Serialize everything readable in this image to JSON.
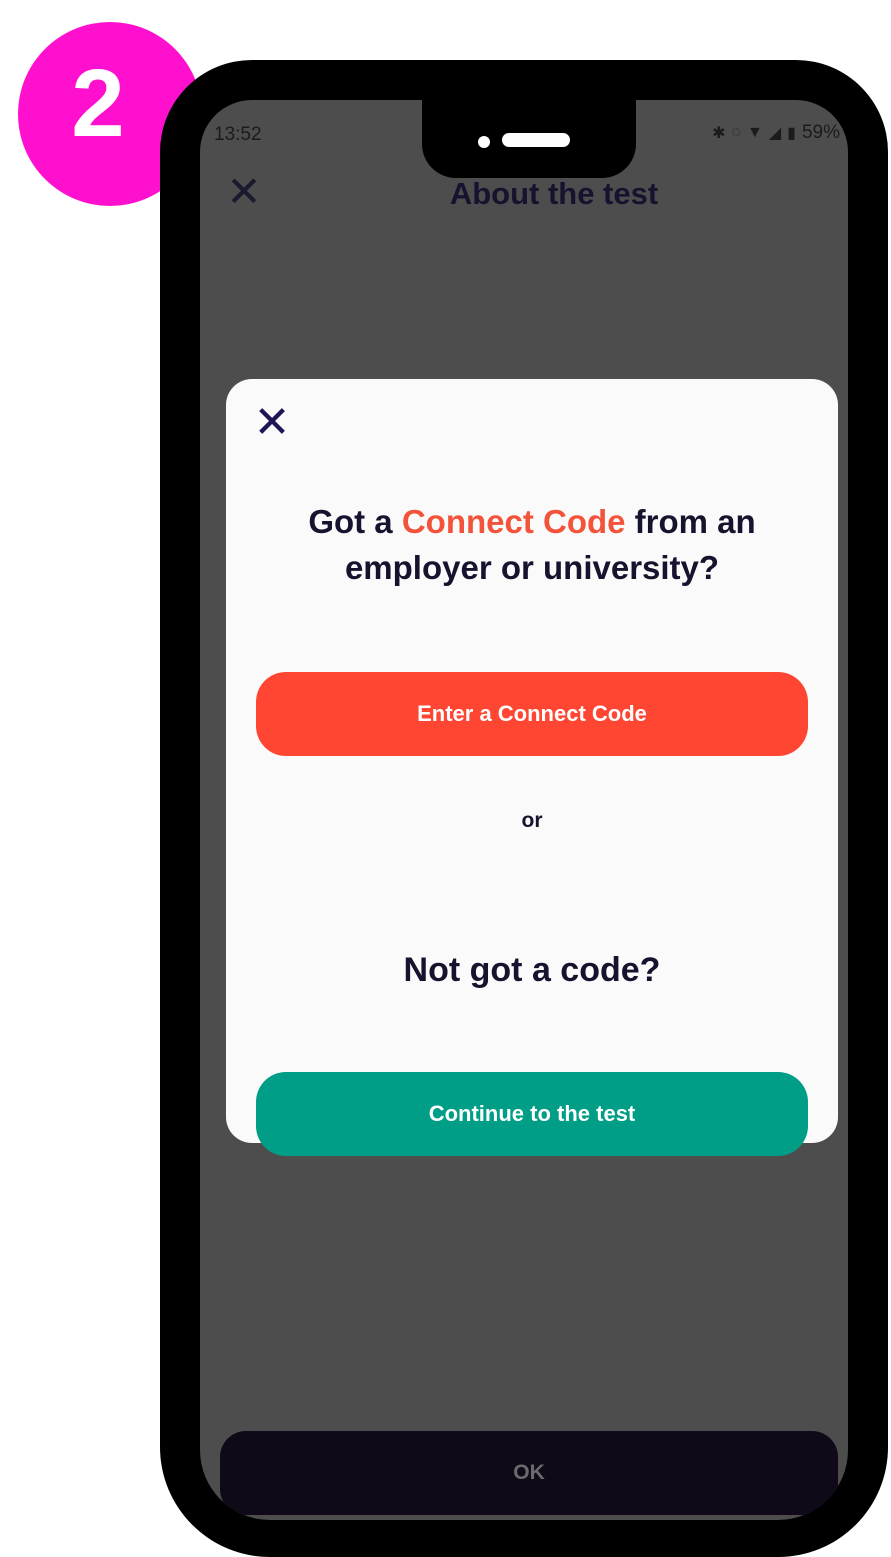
{
  "step_badge": "2",
  "status_bar": {
    "time": "13:52",
    "battery": "59%",
    "icons": [
      "bluetooth-icon",
      "vibrate-icon",
      "wifi-icon",
      "signal-icon",
      "battery-icon"
    ]
  },
  "header": {
    "close_icon": "close-icon",
    "title": "About the test"
  },
  "modal": {
    "close_icon": "close-icon",
    "heading": {
      "part1": "Got a ",
      "accent": "Connect Code",
      "part2": " from an employer or university?"
    },
    "primary_button": "Enter a Connect Code",
    "or": "or",
    "subheading": "Not got a code?",
    "secondary_button": "Continue to the test"
  },
  "footer": {
    "ok_button": "OK"
  },
  "colors": {
    "badge": "#ff10cf",
    "accent": "#f2533a",
    "primary_button": "#ff4633",
    "secondary_button": "#009e86",
    "text_dark": "#15132e",
    "overlay": "#4d4d4d"
  }
}
